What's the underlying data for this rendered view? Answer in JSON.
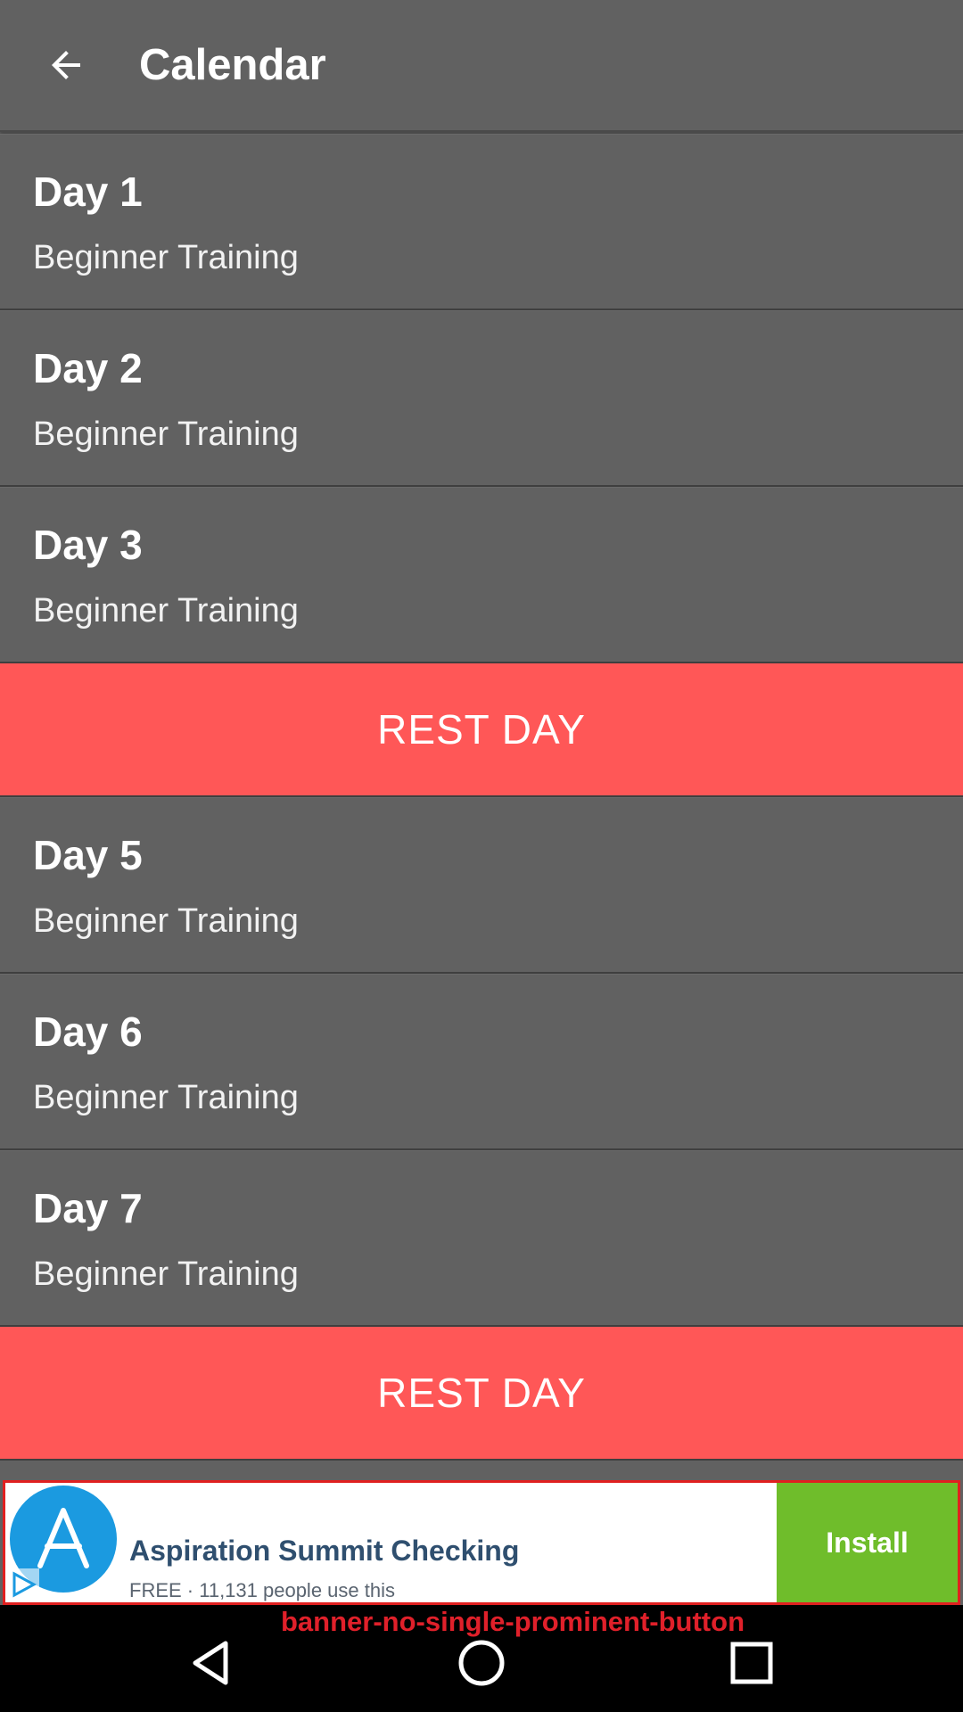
{
  "header": {
    "title": "Calendar"
  },
  "days": [
    {
      "title": "Day 1",
      "subtitle": "Beginner Training"
    },
    {
      "title": "Day 2",
      "subtitle": "Beginner Training"
    },
    {
      "title": "Day 3",
      "subtitle": "Beginner Training"
    },
    {
      "rest_label": "REST DAY"
    },
    {
      "title": "Day 5",
      "subtitle": "Beginner Training"
    },
    {
      "title": "Day 6",
      "subtitle": "Beginner Training"
    },
    {
      "title": "Day 7",
      "subtitle": "Beginner Training"
    },
    {
      "rest_label": "REST DAY"
    }
  ],
  "ad": {
    "title": "Aspiration Summit Checking",
    "subtitle": "FREE · 11,131 people use this",
    "install_label": "Install",
    "logo_letter": "A"
  },
  "annotation": "banner-no-single-prominent-button",
  "colors": {
    "background": "#616161",
    "rest_day": "#ff5757",
    "install": "#6fbd2b",
    "ad_logo": "#1b9ae0",
    "annotation": "#e0202a"
  },
  "icons": {
    "back": "arrow-left-icon",
    "nav_back": "triangle-back-icon",
    "nav_home": "circle-home-icon",
    "nav_recents": "square-recents-icon"
  }
}
